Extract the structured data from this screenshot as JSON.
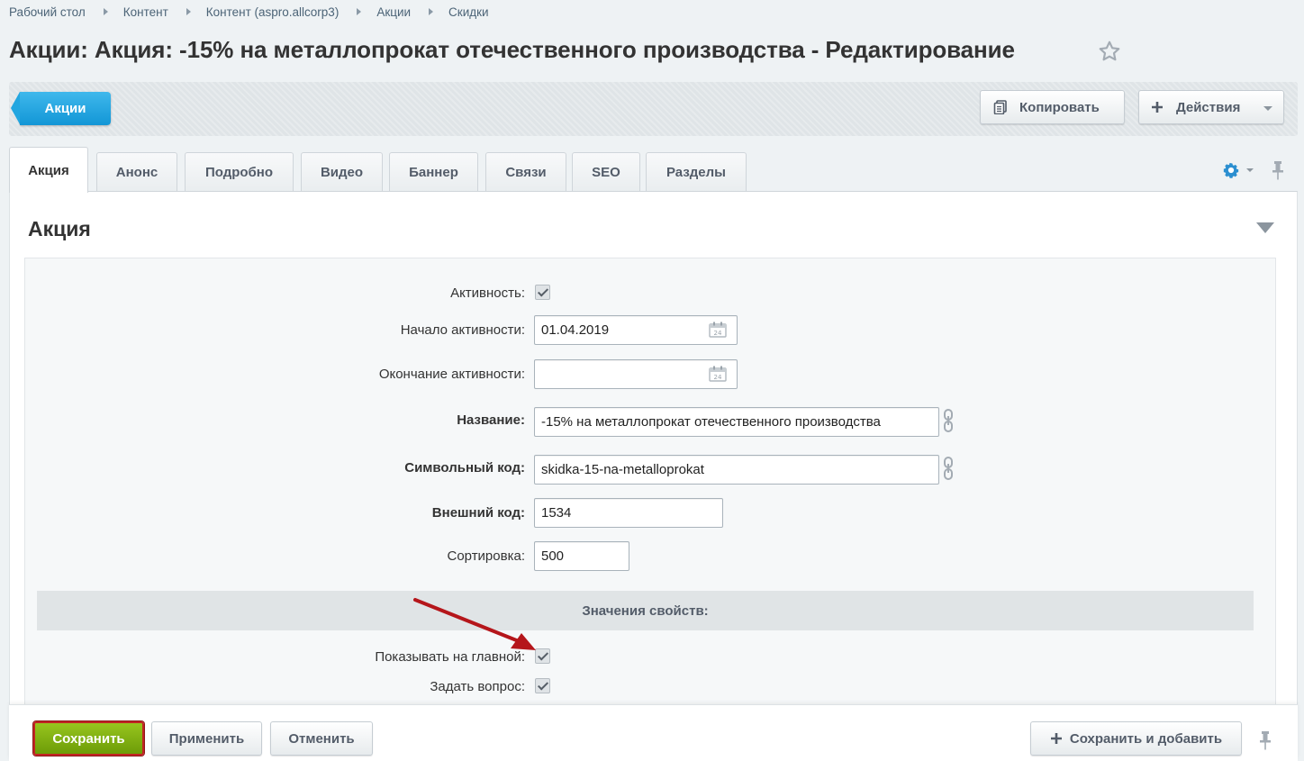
{
  "breadcrumb": [
    "Рабочий стол",
    "Контент",
    "Контент (aspro.allcorp3)",
    "Акции",
    "Скидки"
  ],
  "page_title": "Акции: Акция: -15% на металлопрокат отечественного производства - Редактирование",
  "toolbar": {
    "back_label": "Акции",
    "copy_label": "Копировать",
    "actions_label": "Действия"
  },
  "tabs": [
    "Акция",
    "Анонс",
    "Подробно",
    "Видео",
    "Баннер",
    "Связи",
    "SEO",
    "Разделы"
  ],
  "section_title": "Акция",
  "form": {
    "active_label": "Активность:",
    "active_from_label": "Начало активности:",
    "active_from_value": "01.04.2019",
    "active_to_label": "Окончание активности:",
    "active_to_value": "",
    "name_label": "Название:",
    "name_value": "-15% на металлопрокат отечественного производства",
    "code_label": "Символьный код:",
    "code_value": "skidka-15-na-metalloprokat",
    "xml_id_label": "Внешний код:",
    "xml_id_value": "1534",
    "sort_label": "Сортировка:",
    "sort_value": "500",
    "props_header": "Значения свойств:",
    "show_main_label": "Показывать на главной:",
    "ask_question_label": "Задать вопрос:"
  },
  "footer": {
    "save_label": "Сохранить",
    "apply_label": "Применить",
    "cancel_label": "Отменить",
    "save_add_label": "Сохранить и добавить"
  },
  "colors": {
    "accent": "#1a9fdf",
    "save_green": "#7aab0e",
    "highlight_red": "#c22423"
  },
  "icons": [
    "star-icon",
    "copy-icon",
    "plus-icon",
    "gear-icon",
    "pin-icon",
    "calendar-icon",
    "link-icon",
    "arrow-annotation"
  ]
}
